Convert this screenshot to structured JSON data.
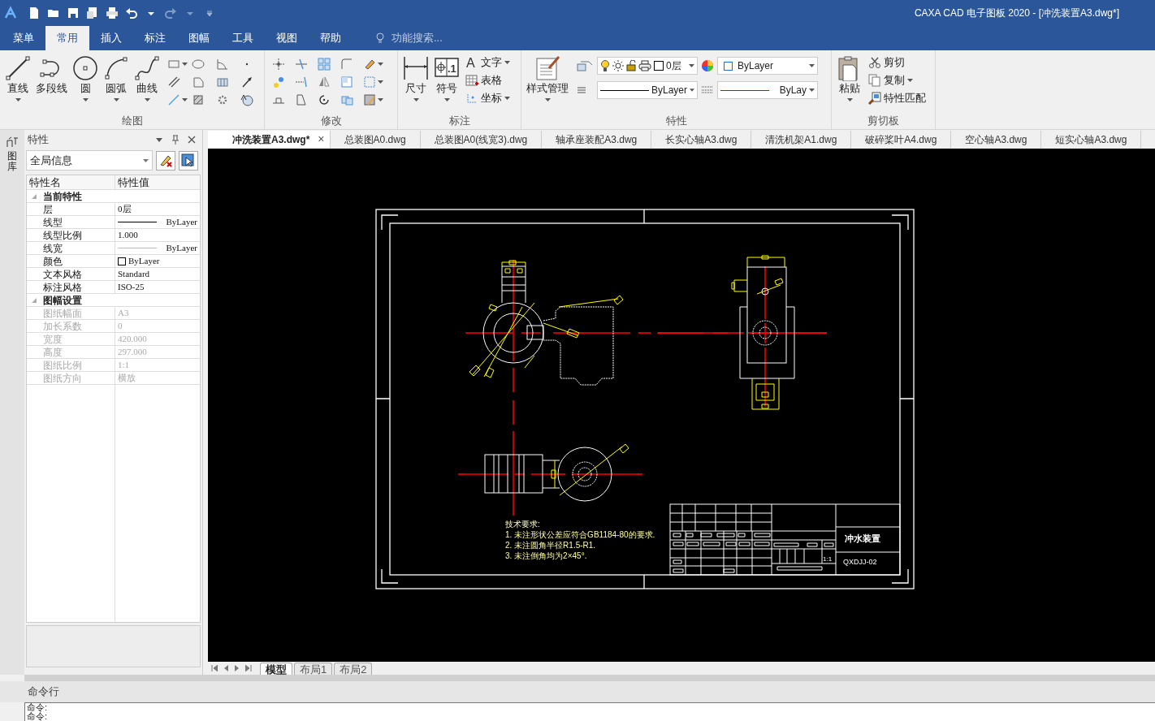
{
  "window": {
    "title": "CAXA CAD 电子图板 2020 - [冲洗装置A3.dwg*]"
  },
  "ribbon_tabs": [
    {
      "label": "菜单",
      "selected": false
    },
    {
      "label": "常用",
      "selected": true
    },
    {
      "label": "插入",
      "selected": false
    },
    {
      "label": "标注",
      "selected": false
    },
    {
      "label": "图幅",
      "selected": false
    },
    {
      "label": "工具",
      "selected": false
    },
    {
      "label": "视图",
      "selected": false
    },
    {
      "label": "帮助",
      "selected": false
    }
  ],
  "search": {
    "placeholder": "功能搜索..."
  },
  "ribbon_groups": [
    {
      "label": "绘图",
      "tools": [
        {
          "kind": "large",
          "label": "直线",
          "dropdown": true
        },
        {
          "kind": "large",
          "label": "多段线",
          "dropdown": false
        },
        {
          "kind": "large",
          "label": "圆",
          "dropdown": true
        },
        {
          "kind": "large",
          "label": "圆弧",
          "dropdown": true
        },
        {
          "kind": "large",
          "label": "曲线",
          "dropdown": true
        }
      ]
    },
    {
      "label": "修改"
    },
    {
      "label": "标注",
      "tools": [
        {
          "kind": "large",
          "label": "尺寸",
          "dropdown": true
        },
        {
          "kind": "large",
          "label": "符号",
          "dropdown": true,
          "icon_text": ".1"
        },
        {
          "kind": "small",
          "label": "文字",
          "dropdown": true,
          "icon_text": "A"
        },
        {
          "kind": "small",
          "label": "表格",
          "dropdown": false
        },
        {
          "kind": "small",
          "label": "坐标",
          "dropdown": true
        }
      ]
    },
    {
      "label": "特性",
      "tools": [
        {
          "kind": "large",
          "label": "样式管理",
          "dropdown": true
        }
      ],
      "combos": [
        {
          "kind": "layer_combo",
          "label": "0层"
        },
        {
          "kind": "color_combo",
          "label": "ByLayer"
        },
        {
          "kind": "linetype_combo",
          "label": "ByLayer"
        },
        {
          "kind": "lineweight_combo",
          "label": "ByLay"
        }
      ]
    },
    {
      "label": "剪切板",
      "tools": [
        {
          "kind": "large",
          "label": "粘贴",
          "dropdown": true
        },
        {
          "kind": "small",
          "label": "剪切",
          "dropdown": false
        },
        {
          "kind": "small",
          "label": "复制",
          "dropdown": true
        },
        {
          "kind": "small",
          "label": "特性匹配",
          "dropdown": false
        }
      ]
    }
  ],
  "side_strip": {
    "label": "图库"
  },
  "properties": {
    "title": "特性",
    "selector": "全局信息",
    "columns": [
      "特性名",
      "特性值"
    ],
    "sections": [
      {
        "title": "当前特性",
        "expanded": true,
        "rows": [
          {
            "name": "层",
            "value": "0层",
            "kind": "text",
            "disabled": false
          },
          {
            "name": "线型",
            "value": "ByLayer",
            "kind": "line",
            "disabled": false
          },
          {
            "name": "线型比例",
            "value": "1.000",
            "kind": "text",
            "disabled": false
          },
          {
            "name": "线宽",
            "value": "ByLayer",
            "kind": "thinline",
            "disabled": false
          },
          {
            "name": "颜色",
            "value": "ByLayer",
            "kind": "swatch",
            "disabled": false
          },
          {
            "name": "文本风格",
            "value": "Standard",
            "kind": "text",
            "disabled": false
          },
          {
            "name": "标注风格",
            "value": "ISO-25",
            "kind": "text",
            "disabled": false
          }
        ]
      },
      {
        "title": "图幅设置",
        "expanded": true,
        "rows": [
          {
            "name": "图纸幅面",
            "value": "A3",
            "kind": "text",
            "disabled": true
          },
          {
            "name": "加长系数",
            "value": "0",
            "kind": "text",
            "disabled": true
          },
          {
            "name": "宽度",
            "value": "420.000",
            "kind": "text",
            "disabled": true
          },
          {
            "name": "高度",
            "value": "297.000",
            "kind": "text",
            "disabled": true
          },
          {
            "name": "图纸比例",
            "value": "1:1",
            "kind": "text",
            "disabled": true
          },
          {
            "name": "图纸方向",
            "value": "横放",
            "kind": "text",
            "disabled": true
          }
        ]
      }
    ]
  },
  "document_tabs": [
    {
      "label": "冲洗装置A3.dwg*",
      "selected": true,
      "close": "×"
    },
    {
      "label": "总装图A0.dwg",
      "selected": false
    },
    {
      "label": "总装图A0(线宽3).dwg",
      "selected": false
    },
    {
      "label": "轴承座装配A3.dwg",
      "selected": false
    },
    {
      "label": "长实心轴A3.dwg",
      "selected": false
    },
    {
      "label": "清洗机架A1.dwg",
      "selected": false
    },
    {
      "label": "破碎桨叶A4.dwg",
      "selected": false
    },
    {
      "label": "空心轴A3.dwg",
      "selected": false
    },
    {
      "label": "短实心轴A3.dwg",
      "selected": false
    }
  ],
  "drawing": {
    "notes": [
      "技术要求:",
      "1. 未注形状公差应符合GB1184-80的要求.",
      "2. 未注圆角半径R1.5-R1.",
      "3. 未注倒角均为2×45°."
    ],
    "title_block": {
      "name": "冲水装置",
      "scale": "1:1",
      "code": "QXDJJ-02"
    }
  },
  "layout_tabs": [
    {
      "label": "模型",
      "selected": true
    },
    {
      "label": "布局1",
      "selected": false
    },
    {
      "label": "布局2",
      "selected": false
    }
  ],
  "command_line": {
    "title": "命令行",
    "lines": [
      "命令:",
      "命令:"
    ]
  }
}
